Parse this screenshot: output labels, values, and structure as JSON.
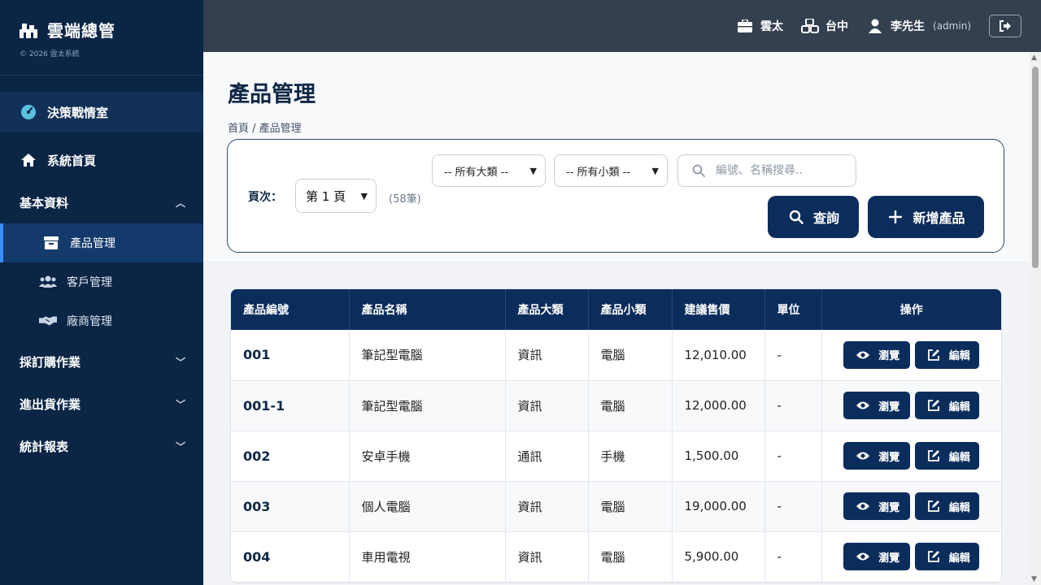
{
  "brand": {
    "title": "雲端總管",
    "copyright": "© 2026 雲太系統"
  },
  "sidebar": {
    "dashboard": "決策戰情室",
    "home": "系統首頁",
    "basic": "基本資料",
    "products": "產品管理",
    "customers": "客戶管理",
    "vendors": "廠商管理",
    "purchase": "採訂購作業",
    "inout": "進出貨作業",
    "reports": "統計報表"
  },
  "topbar": {
    "company": "雲太",
    "branch": "台中",
    "user": "李先生",
    "role": "(admin)"
  },
  "page": {
    "title": "產品管理",
    "breadcrumb": "首頁 / 產品管理"
  },
  "filters": {
    "page_label": "頁次：",
    "page_value": "第 1 頁",
    "count": "(58筆)",
    "category": "-- 所有大類 --",
    "subcategory": "-- 所有小類 --",
    "search_placeholder": "編號、名稱搜尋..",
    "query_label": "查詢",
    "add_label": "新增產品"
  },
  "table": {
    "headers": [
      "產品編號",
      "產品名稱",
      "產品大類",
      "產品小類",
      "建議售價",
      "單位",
      "操作"
    ],
    "view_label": "瀏覽",
    "edit_label": "編輯",
    "rows": [
      {
        "code": "001",
        "name": "筆記型電腦",
        "cat": "資訊",
        "sub": "電腦",
        "price": "12,010.00",
        "unit": "-"
      },
      {
        "code": "001-1",
        "name": "筆記型電腦",
        "cat": "資訊",
        "sub": "電腦",
        "price": "12,000.00",
        "unit": "-"
      },
      {
        "code": "002",
        "name": "安卓手機",
        "cat": "通訊",
        "sub": "手機",
        "price": "1,500.00",
        "unit": "-"
      },
      {
        "code": "003",
        "name": "個人電腦",
        "cat": "資訊",
        "sub": "電腦",
        "price": "19,000.00",
        "unit": "-"
      },
      {
        "code": "004",
        "name": "車用電視",
        "cat": "資訊",
        "sub": "電腦",
        "price": "5,900.00",
        "unit": "-"
      }
    ]
  }
}
